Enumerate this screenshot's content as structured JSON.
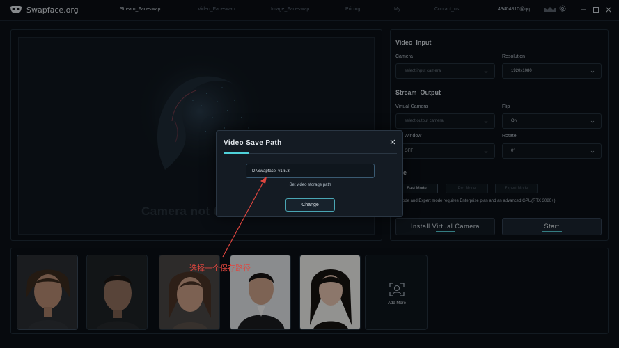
{
  "app": {
    "title": "Swapface.org"
  },
  "nav": [
    {
      "label": "Stream_Faceswap",
      "active": true
    },
    {
      "label": "Video_Faceswap",
      "active": false
    },
    {
      "label": "Image_Faceswap",
      "active": false
    },
    {
      "label": "Pricing",
      "active": false
    },
    {
      "label": "My",
      "active": false
    },
    {
      "label": "Contact_us",
      "active": false
    }
  ],
  "account": {
    "id": "43404810@qq..."
  },
  "camera": {
    "status": "Camera not turned on"
  },
  "settings": {
    "video_input_title": "Video_Input",
    "camera_label": "Camera",
    "camera_value": "select input camera",
    "resolution_label": "Resolution",
    "resolution_value": "1920x1080",
    "stream_output_title": "Stream_Output",
    "virtual_camera_label": "Virtual Camera",
    "virtual_camera_value": "select output camera",
    "flip_label": "Flip",
    "flip_value": "ON",
    "preview_window_label": "iew Window",
    "preview_window_value": "OFF",
    "rotate_label": "Rotate",
    "rotate_value": "0°",
    "mode_title": "ode",
    "modes": [
      "Fast Mode",
      "Pro Mode",
      "Expert Mode"
    ],
    "mode_note": "o mode and Expert mode requires Enterprise plan and an advanced GPU(RTX 3080+)",
    "install_label": "Install Virtual Camera",
    "start_label": "Start"
  },
  "faces": {
    "add_more_label": "Add More"
  },
  "dialog": {
    "title": "Video Save Path",
    "path_value": "D:\\Swapface_v1.5.3",
    "hint": "Set video storage path",
    "change_label": "Change"
  },
  "annotation": {
    "text": "选择一个保存路径"
  },
  "colors": {
    "accent": "#4fd1d9",
    "annotation": "#e0463f",
    "background": "#0c1118"
  },
  "icons": [
    "mask-logo-icon",
    "crown-icon",
    "gear-icon",
    "minimize-icon",
    "maximize-icon",
    "close-icon",
    "chevron-down-icon",
    "face-scan-icon"
  ]
}
